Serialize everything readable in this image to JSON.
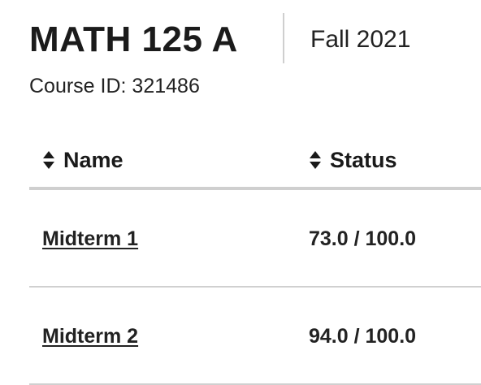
{
  "course": {
    "title": "MATH 125 A",
    "term": "Fall 2021",
    "course_id": "Course ID: 321486"
  },
  "table": {
    "columns": [
      {
        "label": "Name",
        "icon": "sort-icon"
      },
      {
        "label": "Status",
        "icon": "sort-icon"
      }
    ],
    "rows": [
      {
        "name": "Midterm 1",
        "status": "73.0 / 100.0"
      },
      {
        "name": "Midterm 2",
        "status": "94.0 / 100.0"
      }
    ]
  }
}
